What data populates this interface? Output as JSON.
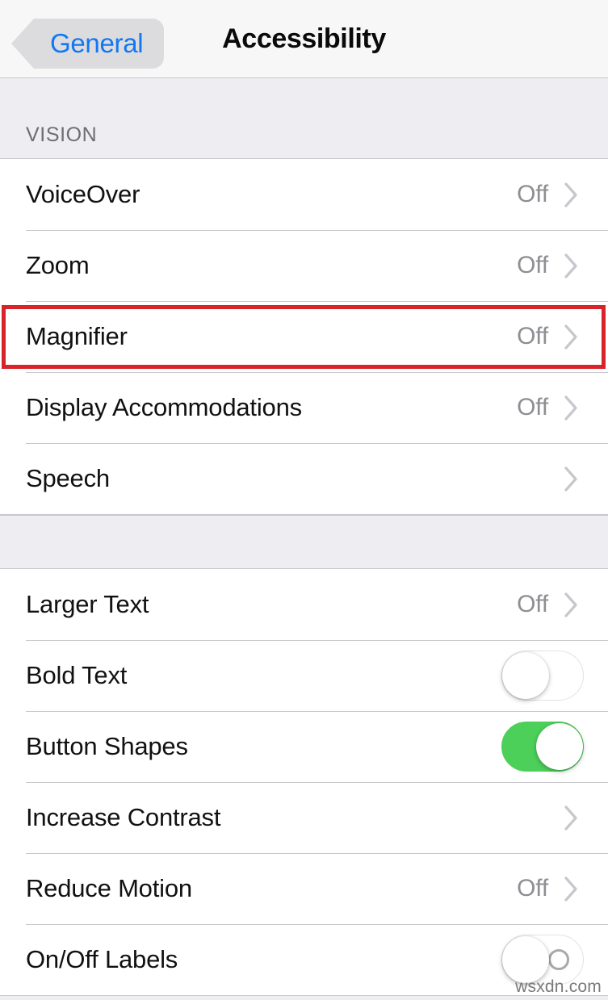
{
  "navbar": {
    "back_label": "General",
    "back_icon": "chevron-left-icon",
    "title": "Accessibility",
    "back_tint": "#1277F2",
    "background": "#F7F7F7"
  },
  "content": {
    "background": "#EDEDF2",
    "sections": [
      {
        "header": "VISION",
        "rows": [
          {
            "label": "VoiceOver",
            "value": "Off",
            "accessory": "chevron"
          },
          {
            "label": "Zoom",
            "value": "Off",
            "accessory": "chevron"
          },
          {
            "label": "Magnifier",
            "value": "Off",
            "accessory": "chevron",
            "highlighted": true
          },
          {
            "label": "Display Accommodations",
            "value": "Off",
            "accessory": "chevron"
          },
          {
            "label": "Speech",
            "value": "",
            "accessory": "chevron"
          }
        ]
      },
      {
        "header": "",
        "rows": [
          {
            "label": "Larger Text",
            "value": "Off",
            "accessory": "chevron"
          },
          {
            "label": "Bold Text",
            "value": "",
            "accessory": "switch",
            "switch_state": "off"
          },
          {
            "label": "Button Shapes",
            "value": "",
            "accessory": "switch",
            "switch_state": "on"
          },
          {
            "label": "Increase Contrast",
            "value": "",
            "accessory": "chevron"
          },
          {
            "label": "Reduce Motion",
            "value": "Off",
            "accessory": "chevron"
          },
          {
            "label": "On/Off Labels",
            "value": "",
            "accessory": "switch",
            "switch_state": "off-labeled"
          }
        ]
      }
    ]
  },
  "annotation": {
    "type": "highlight-rectangle",
    "target": "Magnifier",
    "color": "#D8232A"
  },
  "watermark": {
    "text": "wsxdn.com"
  },
  "colors": {
    "accent_blue": "#1277F2",
    "switch_on_green": "#4CD05A",
    "value_grey": "#8E8E93",
    "chevron_grey": "#C7C7CC",
    "separator": "#C8C7CC",
    "section_bg": "#EDEDF2"
  }
}
